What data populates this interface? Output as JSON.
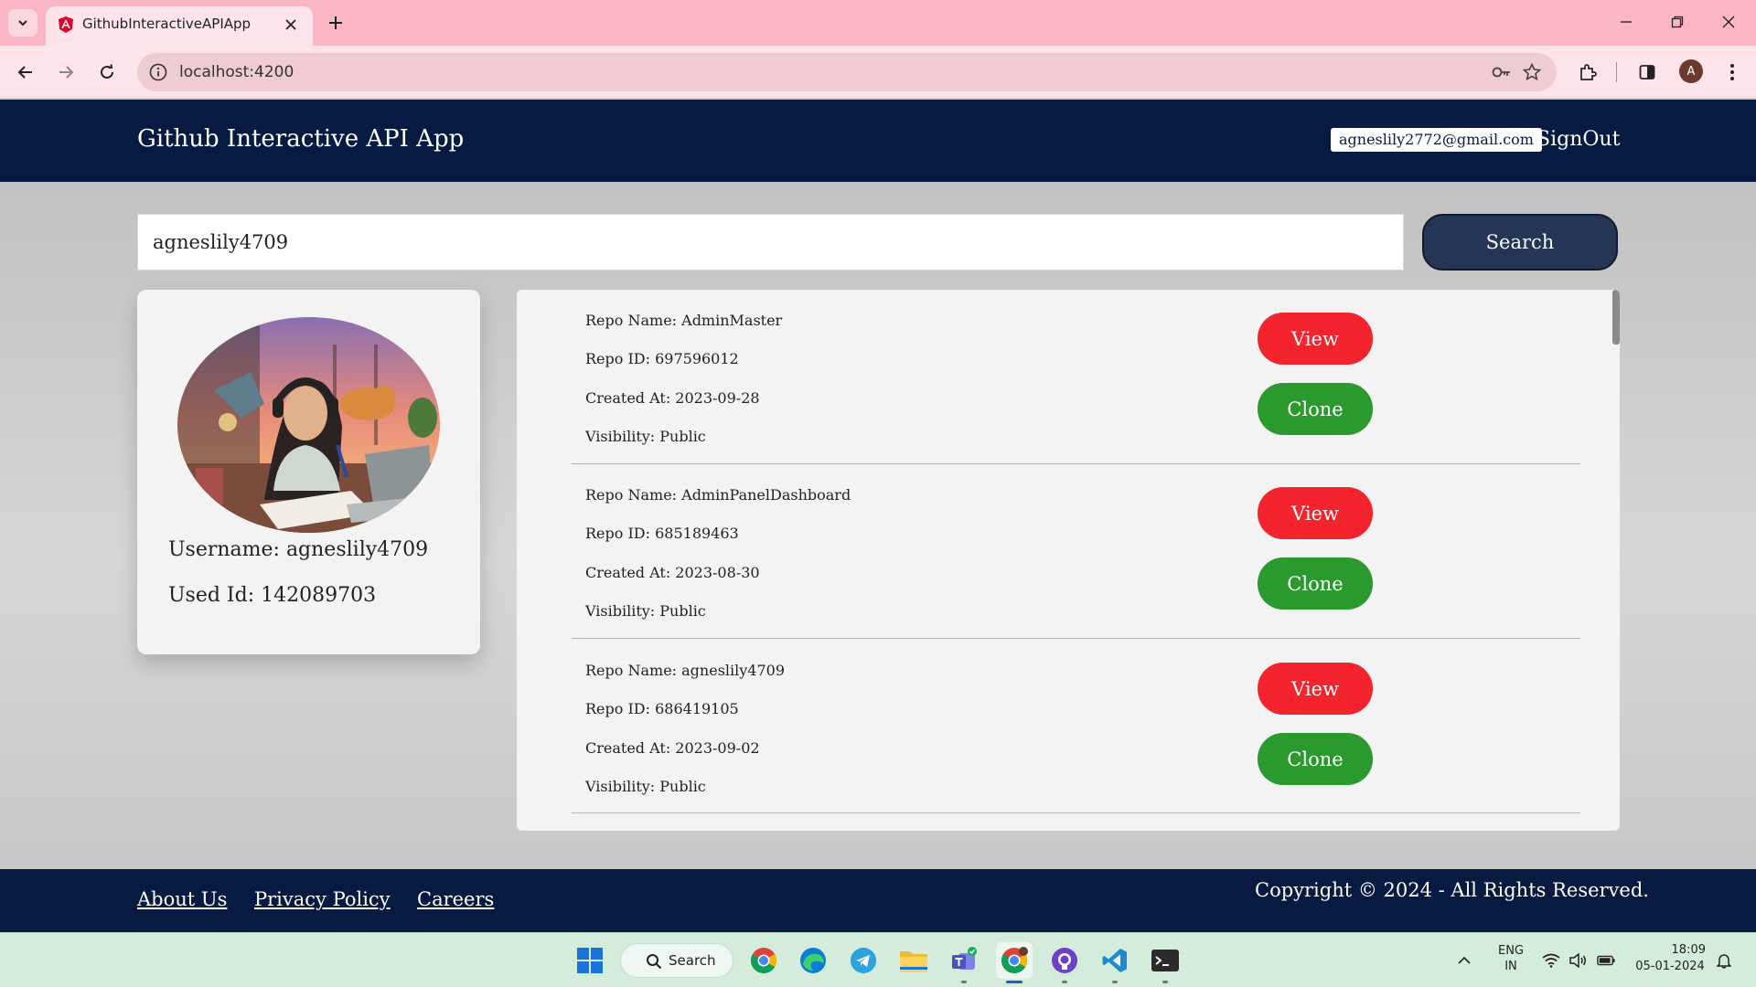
{
  "browser": {
    "tab_title": "GithubInteractiveAPIApp",
    "url": "localhost:4200",
    "profile_initial": "A"
  },
  "header": {
    "title": "Github Interactive API App",
    "user_email": "agneslily2772@gmail.com",
    "signout_label": "SignOut"
  },
  "search": {
    "value": "agneslily4709",
    "button_label": "Search"
  },
  "profile": {
    "username_line": "Username: agneslily4709",
    "userid_line": "Used Id: 142089703"
  },
  "repos": [
    {
      "name_line": "Repo Name: AdminMaster",
      "id_line": "Repo ID: 697596012",
      "created_line": "Created At: 2023-09-28",
      "visibility_line": "Visibility: Public",
      "view_label": "View",
      "clone_label": "Clone"
    },
    {
      "name_line": "Repo Name: AdminPanelDashboard",
      "id_line": "Repo ID: 685189463",
      "created_line": "Created At: 2023-08-30",
      "visibility_line": "Visibility: Public",
      "view_label": "View",
      "clone_label": "Clone"
    },
    {
      "name_line": "Repo Name: agneslily4709",
      "id_line": "Repo ID: 686419105",
      "created_line": "Created At: 2023-09-02",
      "visibility_line": "Visibility: Public",
      "view_label": "View",
      "clone_label": "Clone"
    }
  ],
  "footer": {
    "about_label": "About Us",
    "privacy_label": "Privacy Policy",
    "careers_label": "Careers",
    "copyright": "Copyright © 2024 - All Rights Reserved."
  },
  "taskbar": {
    "search_label": "Search",
    "lang_line1": "ENG",
    "lang_line2": "IN",
    "time": "18:09",
    "date": "05-01-2024"
  },
  "colors": {
    "header_bg": "#061a42",
    "view_button": "#f4242f",
    "clone_button": "#2a9a2f",
    "search_button": "#253555",
    "browser_frame": "#fbb6c6"
  },
  "icons": [
    "tab-list-icon",
    "angular-icon",
    "close-icon",
    "plus-icon",
    "minimize-icon",
    "restore-icon",
    "back-icon",
    "forward-icon",
    "reload-icon",
    "info-icon",
    "key-icon",
    "star-icon",
    "extensions-icon",
    "side-panel-icon",
    "menu-icon",
    "windows-start-icon",
    "chrome-icon",
    "edge-icon",
    "telegram-icon",
    "file-explorer-icon",
    "teams-icon",
    "github-desktop-icon",
    "vscode-icon",
    "terminal-icon",
    "chevron-up-icon",
    "wifi-icon",
    "volume-icon",
    "battery-icon",
    "bell-icon"
  ]
}
